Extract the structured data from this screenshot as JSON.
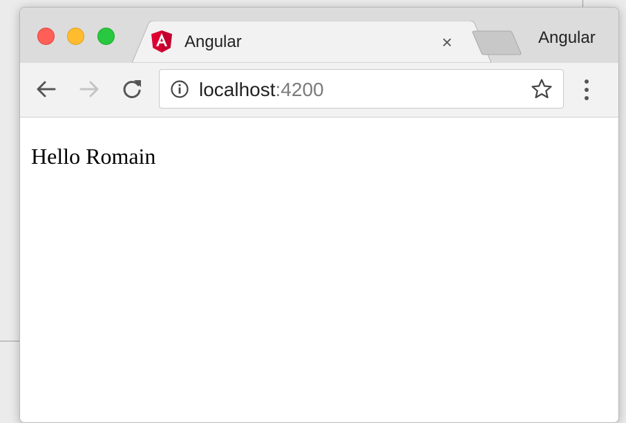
{
  "browser": {
    "tab": {
      "title": "Angular",
      "favicon": "angular-logo",
      "close_glyph": "×"
    },
    "profile_name": "Angular",
    "colors": {
      "close": "#ff5f57",
      "minimize": "#febc2e",
      "maximize": "#28c840",
      "angular_red": "#dd0031"
    }
  },
  "address_bar": {
    "host": "localhost",
    "port": ":4200"
  },
  "icons": {
    "back": "arrow-left-icon",
    "forward": "arrow-right-icon",
    "reload": "reload-icon",
    "info": "info-icon",
    "bookmark": "star-icon",
    "menu": "kebab-menu-icon"
  },
  "page": {
    "text": "Hello Romain"
  }
}
